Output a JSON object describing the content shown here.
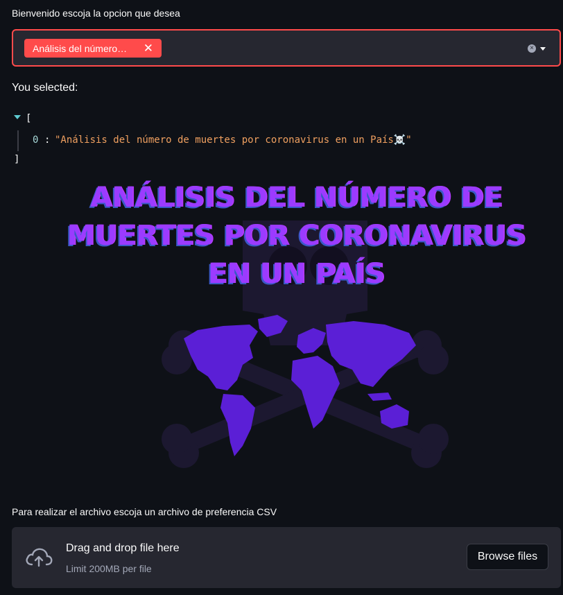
{
  "select": {
    "label": "Bienvenido escoja la opcion que desea",
    "tag_label": "Análisis del número…",
    "tag_remove_icon": "close-icon",
    "clear_icon": "clear-circle-icon",
    "caret_icon": "chevron-down-icon",
    "accent_color": "#ff4b4b"
  },
  "selection": {
    "heading": "You selected:",
    "json_open": "[",
    "json_close": "]",
    "items": [
      {
        "index": "0",
        "value": "\"Análisis del número de muertes por coronavirus en un País☠️\""
      }
    ]
  },
  "banner": {
    "title": "ANÁLISIS DEL NÚMERO DE MUERTES POR CORONAVIRUS EN UN PAÍS",
    "icon": "skull-crossbones-world-map-icon",
    "color": "#7b2ff7"
  },
  "uploader": {
    "label": "Para realizar el archivo escoja un archivo de preferencia CSV",
    "drop_title": "Drag and drop file here",
    "limit_text": "Limit 200MB per file",
    "browse_label": "Browse files",
    "icon": "cloud-upload-icon"
  }
}
